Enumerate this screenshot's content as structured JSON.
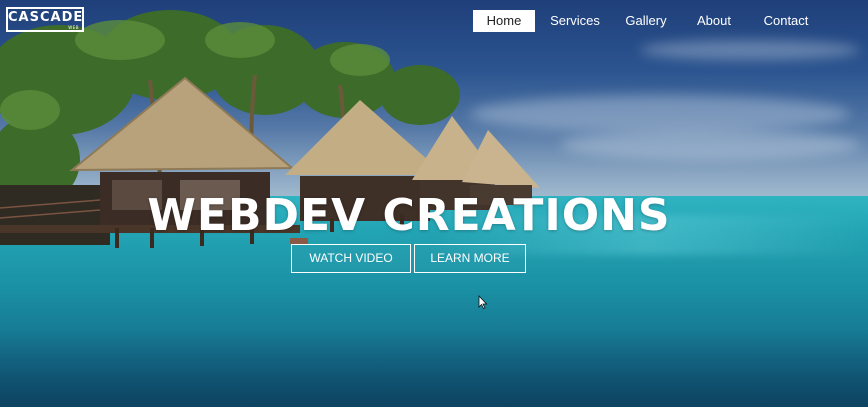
{
  "logo": {
    "text": "CASCADE",
    "sub": "WEB",
    "icon": "logo-mark"
  },
  "nav": {
    "items": [
      {
        "label": "Home",
        "active": true
      },
      {
        "label": "Services",
        "active": false
      },
      {
        "label": "Gallery",
        "active": false
      },
      {
        "label": "About",
        "active": false
      },
      {
        "label": "Contact",
        "active": false
      }
    ]
  },
  "hero": {
    "title": "WEBDEV CREATIONS",
    "buttons": {
      "watch_video": "WATCH VIDEO",
      "learn_more": "LEARN MORE"
    }
  },
  "colors": {
    "text": "#ffffff",
    "active_nav_bg": "#ffffff",
    "active_nav_text": "#222222",
    "sky": "#1f3f7a",
    "sea": "#22a3b3"
  },
  "background": {
    "icon": "tropical-beach-bungalows-image"
  }
}
